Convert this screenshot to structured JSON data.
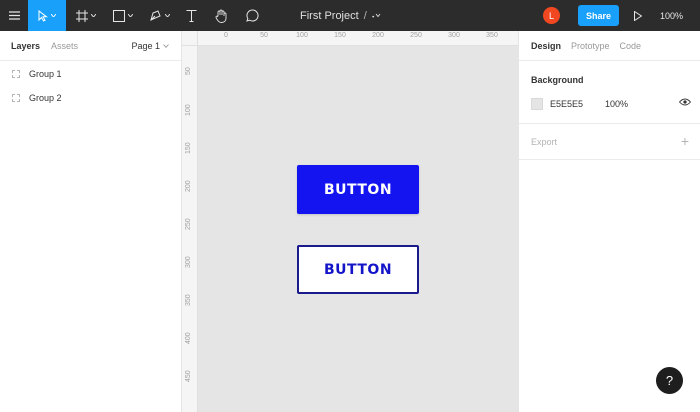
{
  "toolbar": {
    "project_path": "First Project",
    "path_separator": "/",
    "avatar_initial": "L",
    "share_label": "Share",
    "zoom_label": "100%",
    "accent_color": "#18a0fb",
    "avatar_color": "#f24822",
    "tools": [
      "menu-icon",
      "move-icon",
      "frame-icon",
      "rectangle-icon",
      "pen-icon",
      "text-icon",
      "hand-icon",
      "comment-icon"
    ]
  },
  "left_panel": {
    "tabs": [
      "Layers",
      "Assets"
    ],
    "active_tab": "Layers",
    "page_selector": "Page 1",
    "layers": [
      "Group 1",
      "Group 2"
    ]
  },
  "rulers": {
    "top": [
      "0",
      "50",
      "100",
      "150",
      "200",
      "250",
      "300",
      "350"
    ],
    "left": [
      "50",
      "100",
      "150",
      "200",
      "250",
      "300",
      "350",
      "400",
      "450"
    ]
  },
  "canvas": {
    "background": "#e5e5e5",
    "buttons": [
      {
        "label": "BUTTON",
        "style": "filled",
        "color": "#1414f0"
      },
      {
        "label": "BUTTON",
        "style": "outline",
        "color": "#1a1a8c"
      }
    ]
  },
  "right_panel": {
    "tabs": [
      "Design",
      "Prototype",
      "Code"
    ],
    "active_tab": "Design",
    "background_title": "Background",
    "background_hex": "E5E5E5",
    "background_opacity": "100%",
    "export_title": "Export",
    "export_add": "+"
  },
  "help_label": "?"
}
